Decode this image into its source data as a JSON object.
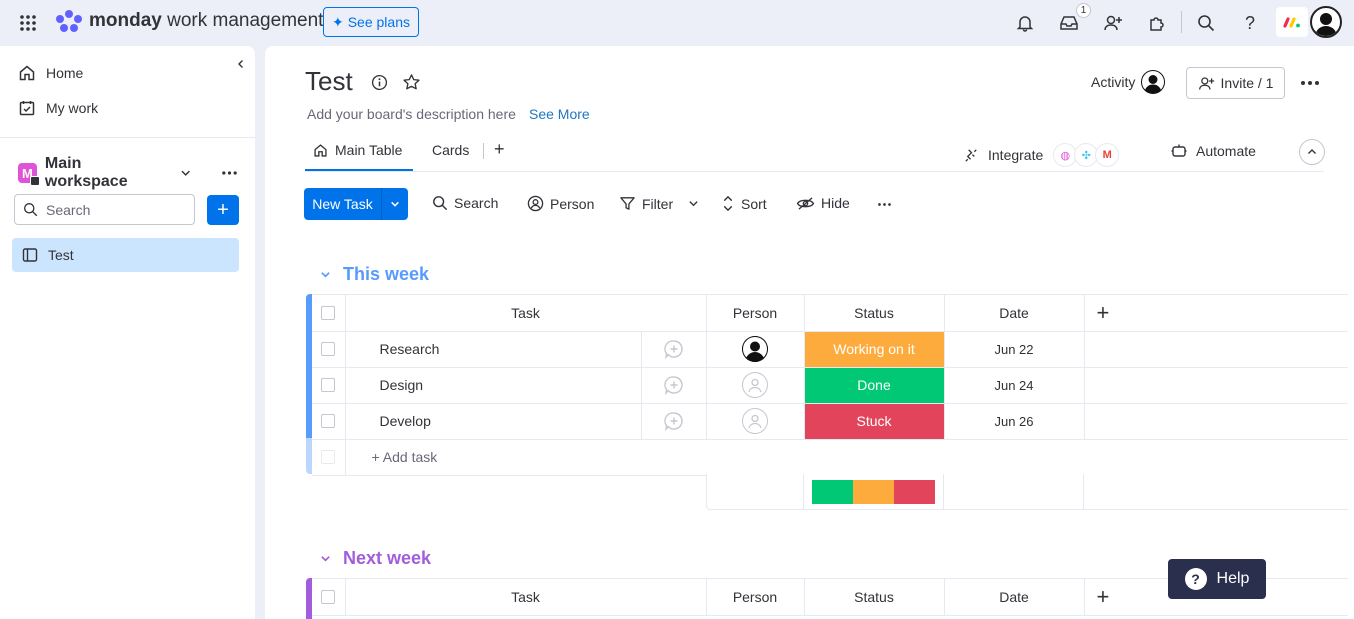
{
  "topbar": {
    "logo_brand": "monday",
    "logo_product": " work management",
    "see_plans": "See plans",
    "inbox_badge": "1"
  },
  "sidebar": {
    "home": "Home",
    "my_work": "My work",
    "workspace_initial": "M",
    "workspace_name": "Main workspace",
    "search_placeholder": "Search",
    "add_label": "+",
    "board_item": "Test"
  },
  "board": {
    "title": "Test",
    "description": "Add your board's description here",
    "see_more": "See More",
    "activity": "Activity",
    "invite": "Invite / 1",
    "tabs": [
      "Main Table",
      "Cards"
    ],
    "add_tab": "+",
    "integrate": "Integrate",
    "automate": "Automate"
  },
  "toolbar": {
    "new_task": "New Task",
    "search": "Search",
    "person": "Person",
    "filter": "Filter",
    "sort": "Sort",
    "hide": "Hide"
  },
  "columns": {
    "task": "Task",
    "person": "Person",
    "status": "Status",
    "date": "Date",
    "add": "+"
  },
  "groups": [
    {
      "title": "This week",
      "color": "#579bfc",
      "rows": [
        {
          "task": "Research",
          "person": "assigned",
          "status": "Working on it",
          "status_color": "#fdab3d",
          "date": "Jun 22"
        },
        {
          "task": "Design",
          "person": "empty",
          "status": "Done",
          "status_color": "#00c875",
          "date": "Jun 24"
        },
        {
          "task": "Develop",
          "person": "empty",
          "status": "Stuck",
          "status_color": "#e2445c",
          "date": "Jun 26"
        }
      ],
      "add_task": "+ Add task",
      "summary_colors": [
        "#00c875",
        "#fdab3d",
        "#e2445c"
      ]
    },
    {
      "title": "Next week",
      "color": "#a25ddc"
    }
  ],
  "help": "Help",
  "help_q": "?"
}
